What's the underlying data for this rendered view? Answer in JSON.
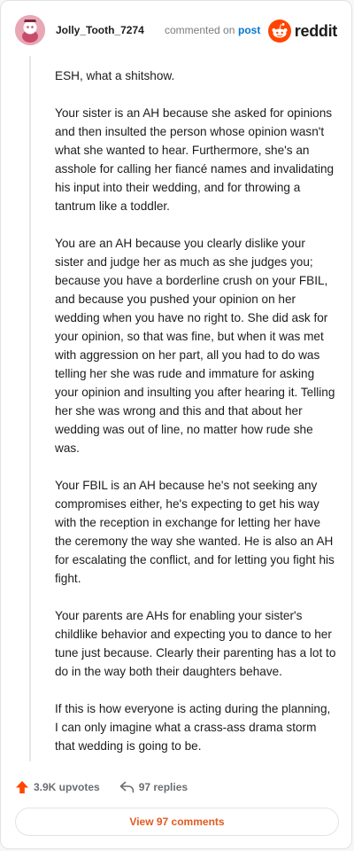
{
  "header": {
    "username": "Jolly_Tooth_7274",
    "commented_on": "commented on",
    "post_link": "post",
    "brand": "reddit"
  },
  "comment": {
    "paragraphs": [
      "ESH, what a shitshow.",
      "Your sister is an AH because she asked for opinions and then insulted the person whose opinion wasn't what she wanted to hear. Furthermore, she's an asshole for calling her fiancé names and invalidating his input into their wedding, and for throwing a tantrum like a toddler.",
      "You are an AH because you clearly dislike your sister and judge her as much as she judges you; because you have a borderline crush on your FBIL, and because you pushed your opinion on her wedding when you have no right to. She did ask for your opinion, so that was fine, but when it was met with aggression on her part, all you had to do was telling her she was rude and immature for asking your opinion and insulting you after hearing it. Telling her she was wrong and this and that about her wedding was out of line, no matter how rude she was.",
      "Your FBIL is an AH because he's not seeking any compromises either, he's expecting to get his way with the reception in exchange for letting her have the ceremony the way she wanted. He is also an AH for escalating the conflict, and for letting you fight his fight.",
      "Your parents are AHs for enabling your sister's childlike behavior and expecting you to dance to her tune just because. Clearly their parenting has a lot to do in the way both their daughters behave.",
      "If this is how everyone is acting during the planning, I can only imagine what a crass-ass drama storm that wedding is going to be."
    ]
  },
  "footer": {
    "upvotes": "3.9K upvotes",
    "replies": "97 replies",
    "view_comments": "View 97 comments"
  },
  "icons": {
    "upvote": "upvote-arrow-icon",
    "reply": "reply-arrow-icon",
    "avatar": "snoo-avatar-icon",
    "logo": "reddit-logo-icon"
  },
  "colors": {
    "accent": "#ff4500",
    "link": "#0079d3",
    "button_text": "#e15a1f",
    "avatar_bg": "#e9a7b6"
  }
}
